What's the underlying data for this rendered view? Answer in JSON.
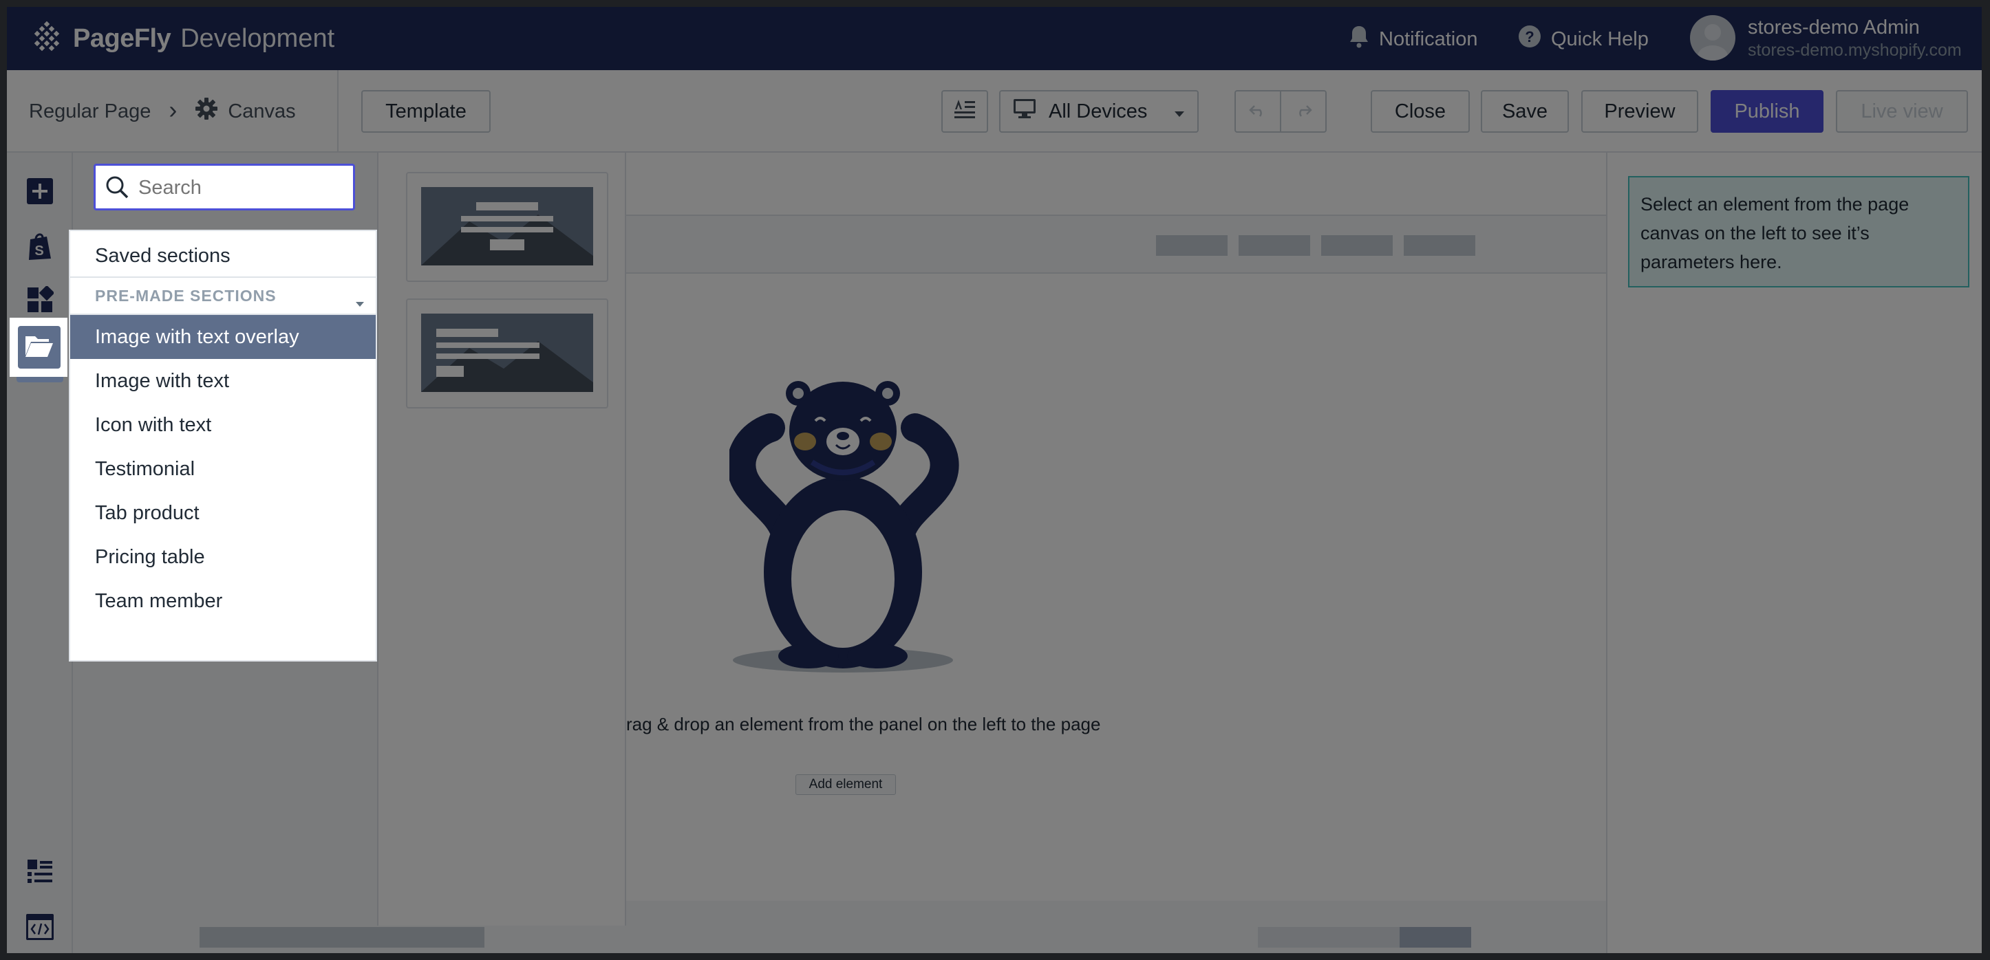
{
  "topbar": {
    "brand": "PageFly",
    "environment": "Development",
    "notification_label": "Notification",
    "quick_help_label": "Quick Help",
    "user_name": "stores-demo Admin",
    "user_store": "stores-demo.myshopify.com"
  },
  "toolbar": {
    "breadcrumb_page": "Regular Page",
    "breadcrumb_separator": "›",
    "breadcrumb_canvas": "Canvas",
    "template_label": "Template",
    "device_label": "All Devices",
    "close_label": "Close",
    "save_label": "Save",
    "preview_label": "Preview",
    "publish_label": "Publish",
    "live_view_label": "Live view"
  },
  "search": {
    "placeholder": "Search"
  },
  "sections_menu": {
    "saved_label": "Saved sections",
    "premade_header": "PRE-MADE SECTIONS",
    "items": [
      {
        "label": "Image with text overlay",
        "selected": true
      },
      {
        "label": "Image with text",
        "selected": false
      },
      {
        "label": "Icon with text",
        "selected": false
      },
      {
        "label": "Testimonial",
        "selected": false
      },
      {
        "label": "Tab product",
        "selected": false
      },
      {
        "label": "Pricing table",
        "selected": false
      },
      {
        "label": "Team member",
        "selected": false
      }
    ]
  },
  "canvas": {
    "hint": "rag & drop an element from the panel on the left to the page",
    "add_element_label": "Add element"
  },
  "right_panel": {
    "info_text": "Select an element from the page canvas on the left to see it’s parameters here."
  },
  "colors": {
    "topbar_bg": "#1f2a5a",
    "publish_bg": "#4c4fd6",
    "selected_item_bg": "#5e6e8b",
    "info_border": "#47c1bf"
  }
}
